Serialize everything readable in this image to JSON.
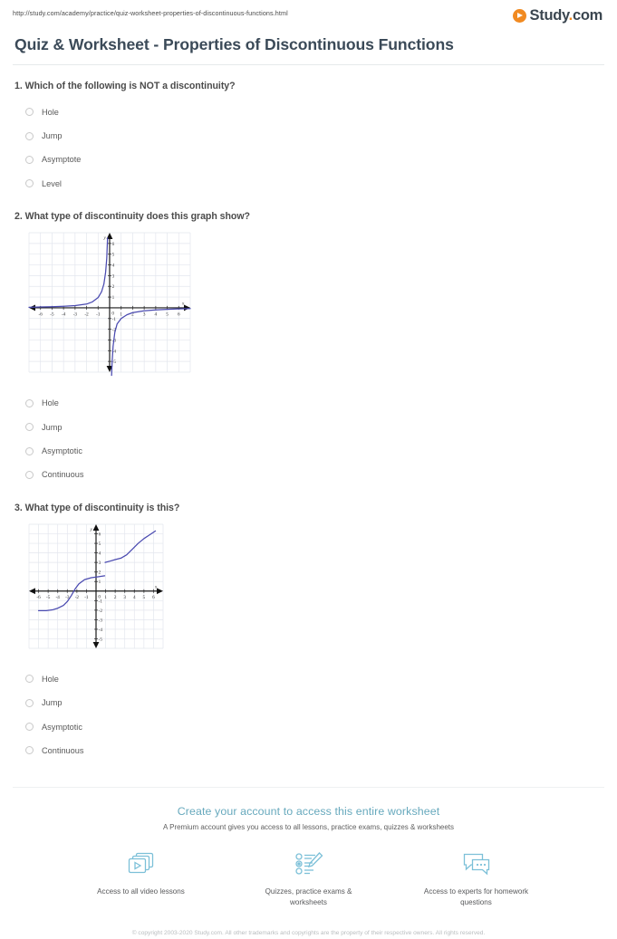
{
  "browser": {
    "url": "http://study.com/academy/practice/quiz-worksheet-properties-of-discontinuous-functions.html"
  },
  "logo": {
    "name": "Study",
    "dot": ".",
    "tld": "com",
    "mark_color": "#f18a21",
    "text_color": "#3b4650"
  },
  "header": {
    "title": "Quiz & Worksheet - Properties of Discontinuous Functions"
  },
  "questions": [
    {
      "number": "1.",
      "text": "1. Which of the following is NOT a discontinuity?",
      "has_graph": false,
      "choices": [
        "Hole",
        "Jump",
        "Asymptote",
        "Level"
      ]
    },
    {
      "number": "2.",
      "text": "2. What type of discontinuity does this graph show?",
      "has_graph": true,
      "choices": [
        "Hole",
        "Jump",
        "Asymptotic",
        "Continuous"
      ]
    },
    {
      "number": "3.",
      "text": "3. What type of discontinuity is this?",
      "has_graph": true,
      "choices": [
        "Hole",
        "Jump",
        "Asymptotic",
        "Continuous"
      ]
    }
  ],
  "chart_data": [
    {
      "type": "line",
      "title": "",
      "question": 2,
      "description": "Hyperbola with vertical asymptote at x = 0 and horizontal asymptote at y = 0",
      "xlabel": "x",
      "ylabel": "y",
      "xlim": [
        -7,
        7
      ],
      "ylim": [
        -6,
        7
      ],
      "xticks": [
        -6,
        -5,
        -4,
        -3,
        -2,
        -1,
        0,
        1,
        2,
        3,
        4,
        5,
        6
      ],
      "yticks": [
        -5,
        -4,
        -3,
        -2,
        -1,
        0,
        1,
        2,
        3,
        4,
        5,
        6
      ],
      "grid": true,
      "curve_color": "#4a4ab0",
      "asymptote_x": 0,
      "asymptote_y": 0,
      "branches": [
        {
          "name": "left",
          "x": [
            -7,
            -6,
            -5,
            -4,
            -3,
            -2,
            -1.5,
            -1,
            -0.7,
            -0.5,
            -0.35,
            -0.25,
            -0.18
          ],
          "y": [
            0.05,
            0.08,
            0.1,
            0.14,
            0.2,
            0.35,
            0.55,
            0.95,
            1.5,
            2.2,
            3.3,
            4.6,
            6.5
          ]
        },
        {
          "name": "right",
          "x": [
            0.17,
            0.22,
            0.3,
            0.45,
            0.65,
            1,
            1.5,
            2,
            3,
            4,
            5,
            6,
            7
          ],
          "y": [
            -6.3,
            -5.0,
            -3.6,
            -2.3,
            -1.5,
            -1.0,
            -0.65,
            -0.45,
            -0.28,
            -0.2,
            -0.14,
            -0.1,
            -0.07
          ]
        }
      ]
    },
    {
      "type": "line",
      "title": "",
      "question": 3,
      "description": "Increasing sigmoid-like curve with a jump discontinuity near x = 0.9 from y = 1.6 up to y = 3",
      "xlabel": "x",
      "ylabel": "y",
      "xlim": [
        -7,
        7
      ],
      "ylim": [
        -6,
        7
      ],
      "xticks": [
        -6,
        -5,
        -4,
        -3,
        -2,
        -1,
        0,
        1,
        2,
        3,
        4,
        5,
        6
      ],
      "yticks": [
        -5,
        -4,
        -3,
        -2,
        -1,
        0,
        1,
        2,
        3,
        4,
        5,
        6
      ],
      "grid": true,
      "curve_color": "#4a4ab0",
      "jump_x": 0.9,
      "jump_from_y": 1.6,
      "jump_to_y": 3.0,
      "branches": [
        {
          "name": "left",
          "x": [
            -6,
            -5.2,
            -4.5,
            -4,
            -3.4,
            -3,
            -2.6,
            -2.2,
            -1.8,
            -1.2,
            -0.5,
            0.2,
            0.9
          ],
          "y": [
            -2.05,
            -2.05,
            -1.95,
            -1.8,
            -1.5,
            -1.1,
            -0.5,
            0.2,
            0.75,
            1.2,
            1.4,
            1.5,
            1.6
          ]
        },
        {
          "name": "right",
          "x": [
            0.95,
            1.5,
            2,
            2.6,
            3.2,
            3.8,
            4.4,
            5,
            5.6,
            6.2
          ],
          "y": [
            3.0,
            3.15,
            3.3,
            3.45,
            3.8,
            4.4,
            5.0,
            5.5,
            5.9,
            6.3
          ]
        }
      ]
    }
  ],
  "cta": {
    "headline": "Create your account to access this entire worksheet",
    "subtext": "A Premium account gives you access to all lessons, practice exams, quizzes & worksheets",
    "accent_color": "#67a9bd",
    "features": [
      {
        "icon": "video-play-cards-icon",
        "label": "Access to all\nvideo lessons"
      },
      {
        "icon": "quiz-list-pencil-icon",
        "label": "Quizzes, practice exams\n& worksheets"
      },
      {
        "icon": "chat-bubbles-icon",
        "label": "Access to experts for\nhomework questions"
      }
    ]
  },
  "footer": {
    "copyright": "© copyright 2003-2020 Study.com. All other trademarks and copyrights are the property of their respective owners. All rights reserved."
  }
}
